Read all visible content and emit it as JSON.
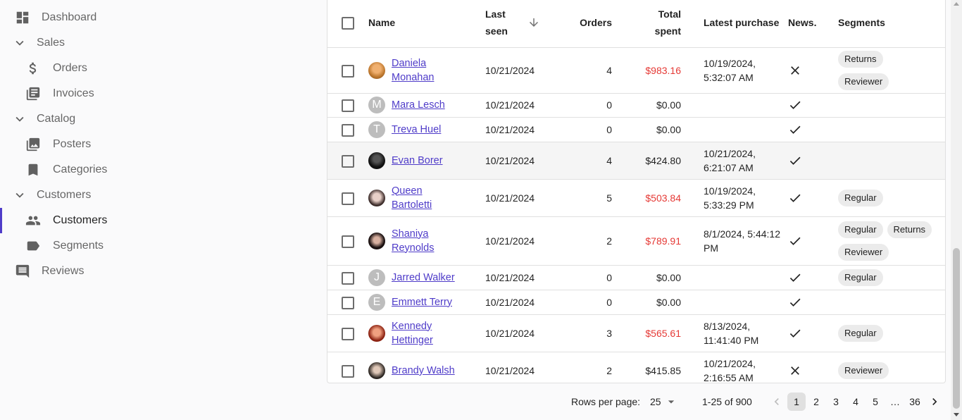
{
  "sidebar": {
    "dashboard": "Dashboard",
    "sales": "Sales",
    "orders": "Orders",
    "invoices": "Invoices",
    "catalog": "Catalog",
    "posters": "Posters",
    "categories": "Categories",
    "customers_group": "Customers",
    "customers": "Customers",
    "segments": "Segments",
    "reviews": "Reviews"
  },
  "table": {
    "headers": {
      "name": "Name",
      "last_seen_1": "Last",
      "last_seen_2": "seen",
      "orders": "Orders",
      "total_1": "Total",
      "total_2": "spent",
      "latest_purchase": "Latest purchase",
      "news": "News.",
      "segments": "Segments"
    },
    "rows": [
      {
        "name_1": "Daniela",
        "name_2": "Monahan",
        "last_seen": "10/21/2024",
        "orders": "4",
        "total": "$983.16",
        "latest_1": "10/19/2024,",
        "latest_2": "5:32:07 AM",
        "seg_1": "Returns",
        "seg_2": "Reviewer",
        "seg_3": ""
      },
      {
        "name_1": "Mara Lesch",
        "name_2": "",
        "avatar_letter": "M",
        "last_seen": "10/21/2024",
        "orders": "0",
        "total": "$0.00",
        "latest_1": "",
        "latest_2": ""
      },
      {
        "name_1": "Treva Huel",
        "name_2": "",
        "avatar_letter": "T",
        "last_seen": "10/21/2024",
        "orders": "0",
        "total": "$0.00",
        "latest_1": "",
        "latest_2": ""
      },
      {
        "name_1": "Evan Borer",
        "name_2": "",
        "last_seen": "10/21/2024",
        "orders": "4",
        "total": "$424.80",
        "latest_1": "10/21/2024,",
        "latest_2": "6:21:07 AM"
      },
      {
        "name_1": "Queen",
        "name_2": "Bartoletti",
        "last_seen": "10/21/2024",
        "orders": "5",
        "total": "$503.84",
        "latest_1": "10/19/2024,",
        "latest_2": "5:33:29 PM",
        "seg_1": "Regular"
      },
      {
        "name_1": "Shaniya",
        "name_2": "Reynolds",
        "last_seen": "10/21/2024",
        "orders": "2",
        "total": "$789.91",
        "latest_1": "8/1/2024, 5:44:12",
        "latest_2": "PM",
        "seg_1": "Regular",
        "seg_2": "Returns",
        "seg_3": "Reviewer"
      },
      {
        "name_1": "Jarred Walker",
        "name_2": "",
        "avatar_letter": "J",
        "last_seen": "10/21/2024",
        "orders": "0",
        "total": "$0.00",
        "latest_1": "",
        "latest_2": "",
        "seg_1": "Regular"
      },
      {
        "name_1": "Emmett Terry",
        "name_2": "",
        "avatar_letter": "E",
        "last_seen": "10/21/2024",
        "orders": "0",
        "total": "$0.00",
        "latest_1": "",
        "latest_2": ""
      },
      {
        "name_1": "Kennedy",
        "name_2": "Hettinger",
        "last_seen": "10/21/2024",
        "orders": "3",
        "total": "$565.61",
        "latest_1": "8/13/2024,",
        "latest_2": "11:41:40 PM",
        "seg_1": "Regular"
      },
      {
        "name_1": "Brandy Walsh",
        "name_2": "",
        "last_seen": "10/21/2024",
        "orders": "2",
        "total": "$415.85",
        "latest_1": "10/21/2024,",
        "latest_2": "2:16:55 AM",
        "seg_1": "Reviewer"
      }
    ]
  },
  "pagination": {
    "rows_per_page_label": "Rows per page:",
    "rows_per_page_value": "25",
    "range": "1-25 of 900",
    "pages": [
      "1",
      "2",
      "3",
      "4",
      "5",
      "…",
      "36"
    ]
  },
  "colors": {
    "accent": "#4f3cc9",
    "highlight_total": "#e53935"
  }
}
